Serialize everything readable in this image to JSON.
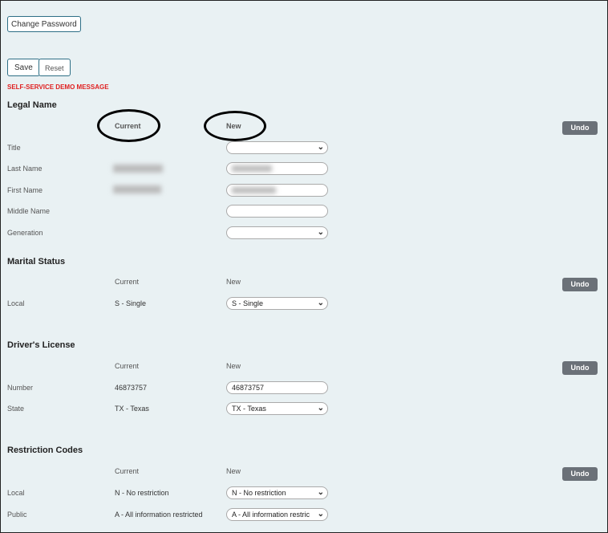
{
  "buttons": {
    "change_password": "Change Password",
    "save": "Save",
    "reset": "Reset",
    "undo": "Undo"
  },
  "message": "SELF-SERVICE DEMO MESSAGE",
  "columns": {
    "current": "Current",
    "new": "New"
  },
  "legal_name": {
    "title": "Legal Name",
    "rows": [
      {
        "label": "Title",
        "current": "",
        "new": "",
        "type": "select"
      },
      {
        "label": "Last Name",
        "current": "",
        "new": "",
        "type": "text"
      },
      {
        "label": "First Name",
        "current": "",
        "new": "",
        "type": "text"
      },
      {
        "label": "Middle Name",
        "current": "",
        "new": "",
        "type": "text"
      },
      {
        "label": "Generation",
        "current": "",
        "new": "",
        "type": "select"
      }
    ]
  },
  "marital_status": {
    "title": "Marital Status",
    "rows": [
      {
        "label": "Local",
        "current": "S - Single",
        "new": "S - Single"
      }
    ]
  },
  "drivers_license": {
    "title": "Driver's License",
    "rows": [
      {
        "label": "Number",
        "current": "46873757",
        "new": "46873757"
      },
      {
        "label": "State",
        "current": "TX - Texas",
        "new": "TX - Texas"
      }
    ]
  },
  "restriction_codes": {
    "title": "Restriction Codes",
    "rows": [
      {
        "label": "Local",
        "current": "N - No restriction",
        "new": "N - No restriction"
      },
      {
        "label": "Public",
        "current": "A - All information restricted",
        "new": "A - All information restric"
      }
    ]
  }
}
